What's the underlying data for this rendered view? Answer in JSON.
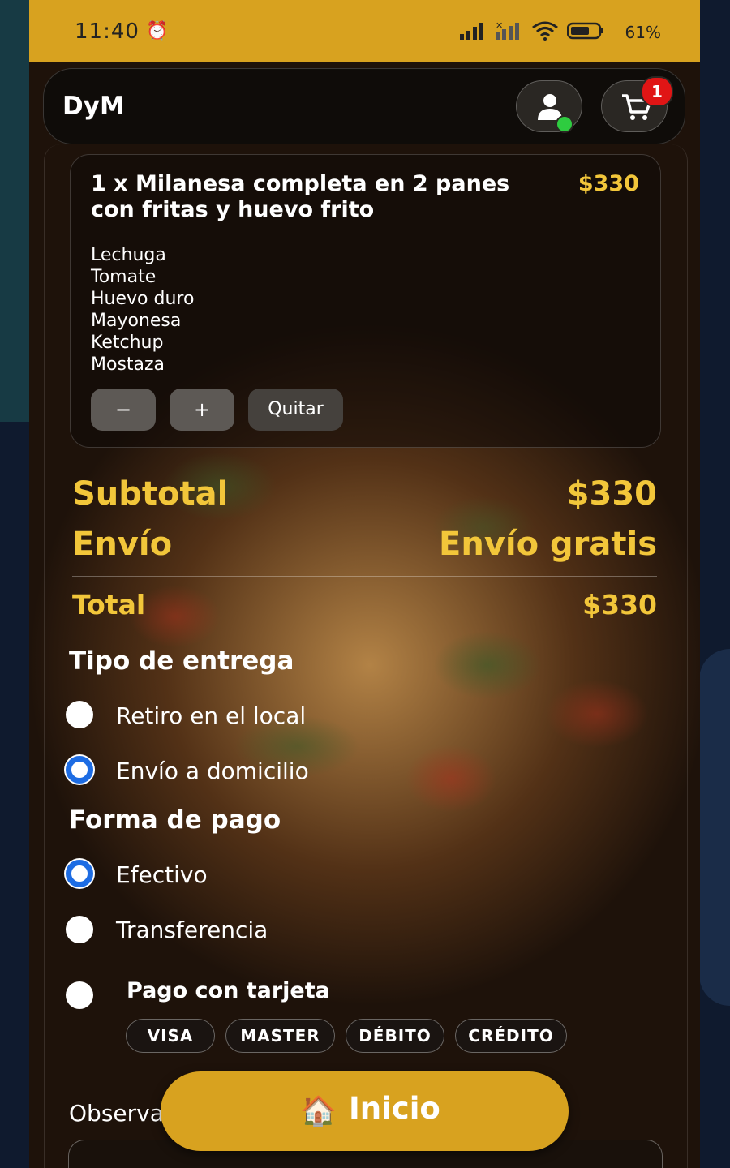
{
  "status_bar": {
    "time": "11:40",
    "battery": "61%"
  },
  "app": {
    "brand": "DyM",
    "cart_count": "1"
  },
  "item": {
    "title": "1 x Milanesa completa en 2 panes con fritas y huevo frito",
    "price": "$330",
    "ingredients": [
      "Lechuga",
      "Tomate",
      "Huevo duro",
      "Mayonesa",
      "Ketchup",
      "Mostaza"
    ],
    "minus_label": "−",
    "plus_label": "+",
    "remove_label": "Quitar"
  },
  "summary": {
    "subtotal_label": "Subtotal",
    "subtotal_value": "$330",
    "shipping_label": "Envío",
    "shipping_value": "Envío gratis",
    "total_label": "Total",
    "total_value": "$330"
  },
  "delivery": {
    "title": "Tipo de entrega",
    "options": [
      {
        "label": "Retiro en el local",
        "checked": false
      },
      {
        "label": "Envío a domicilio",
        "checked": true
      }
    ]
  },
  "payment": {
    "title": "Forma de pago",
    "options": [
      {
        "label": "Efectivo",
        "checked": true
      },
      {
        "label": "Transferencia",
        "checked": false
      },
      {
        "label": "Pago con tarjeta",
        "checked": false
      }
    ],
    "cards": [
      "VISA",
      "MASTER",
      "DÉBITO",
      "CRÉDITO"
    ]
  },
  "observations": {
    "label": "Observa"
  },
  "home_button": {
    "label": "Inicio",
    "icon": "🏠"
  },
  "colors": {
    "accent": "#d8a21f",
    "price": "#f2c63a",
    "radio": "#1d6ce3",
    "badge": "#e01515"
  }
}
